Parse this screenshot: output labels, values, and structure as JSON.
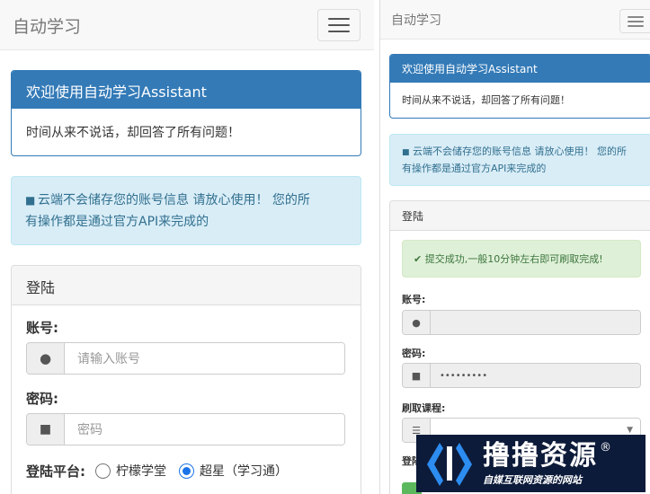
{
  "left": {
    "brand": "自动学习",
    "welcome_title": "欢迎使用自动学习Assistant",
    "welcome_body": "时间从来不说话，却回答了所有问题！",
    "notice_line1": "云端不会储存您的账号信息 请放心使用！ 您的所",
    "notice_line2": "有操作都是通过官方API来完成的",
    "login_title": "登陆",
    "account_label": "账号:",
    "account_placeholder": "请输入账号",
    "password_label": "密码:",
    "password_placeholder": "密码",
    "platform_label": "登陆平台:",
    "platform_options": [
      {
        "label": "柠檬学堂",
        "selected": false
      },
      {
        "label": "超星（学习通）",
        "selected": true
      }
    ]
  },
  "right": {
    "brand": "自动学习",
    "welcome_title": "欢迎使用自动学习Assistant",
    "welcome_body": "时间从来不说话，却回答了所有问题！",
    "notice_line1": "云端不会储存您的账号信息 请放心使用！ 您的所",
    "notice_line2": "有操作都是通过官方API来完成的",
    "login_title": "登陆",
    "success_message": "提交成功,一般10分钟左右即可刷取完成!",
    "account_label": "账号:",
    "password_label": "密码:",
    "password_value": "•••••••••",
    "course_label": "刷取课程:",
    "partial_label": "登陆"
  },
  "watermark": {
    "text": "撸撸资源",
    "registered": "®",
    "subtitle": "自媒互联网资源的网站"
  },
  "colors": {
    "primary": "#337ab7",
    "info_bg": "#d9edf7",
    "info_text": "#31708f",
    "success_bg": "#dff0d8",
    "success_text": "#3c763d",
    "radio_on": "#1a73e8"
  }
}
